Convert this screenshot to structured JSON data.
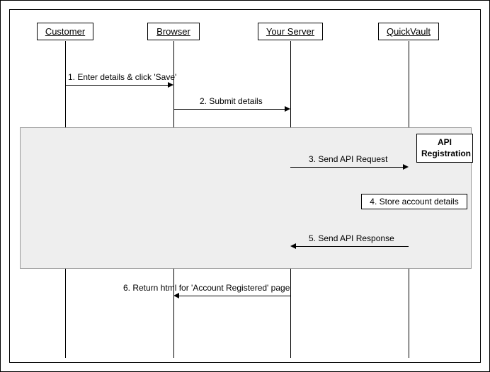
{
  "participants": {
    "customer": "Customer",
    "browser": "Browser",
    "server": "Your Server",
    "quickvault": "QuickVault"
  },
  "api_registration_label": "API Registration",
  "messages": {
    "m1": "1. Enter details & click 'Save'",
    "m2": "2. Submit details",
    "m3": "3. Send API Request",
    "m4": "4. Store account details",
    "m5": "5. Send API Response",
    "m6": "6. Return html for 'Account Registered' page"
  },
  "chart_data": {
    "type": "table",
    "title": "UML Sequence Diagram — API Registration flow",
    "participants": [
      "Customer",
      "Browser",
      "Your Server",
      "QuickVault"
    ],
    "box": {
      "name": "API Registration",
      "covers_steps": [
        3,
        4,
        5
      ]
    },
    "messages": [
      {
        "step": 1,
        "from": "Customer",
        "to": "Browser",
        "label": "Enter details & click 'Save'"
      },
      {
        "step": 2,
        "from": "Browser",
        "to": "Your Server",
        "label": "Submit details"
      },
      {
        "step": 3,
        "from": "Your Server",
        "to": "QuickVault",
        "label": "Send API Request"
      },
      {
        "step": 4,
        "from": "QuickVault",
        "to": "QuickVault",
        "label": "Store account details"
      },
      {
        "step": 5,
        "from": "QuickVault",
        "to": "Your Server",
        "label": "Send API Response"
      },
      {
        "step": 6,
        "from": "Your Server",
        "to": "Browser",
        "label": "Return html for 'Account Registered' page"
      }
    ]
  }
}
